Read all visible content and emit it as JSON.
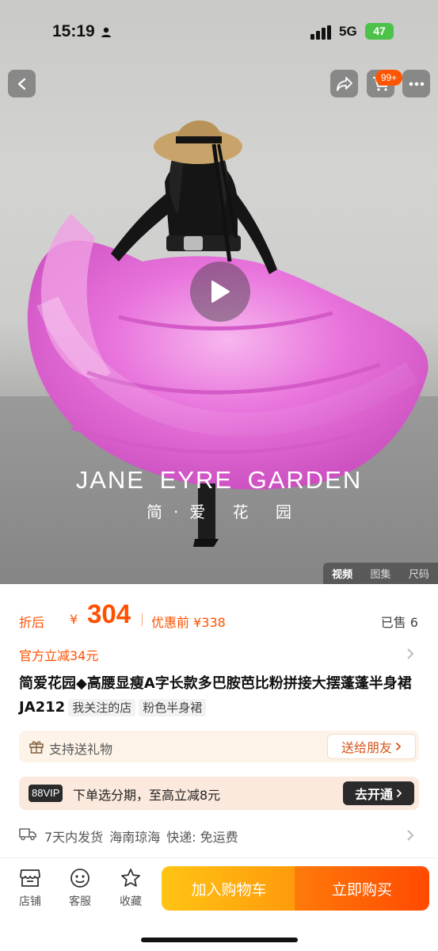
{
  "status_bar": {
    "time": "15:19",
    "network": "5G",
    "battery": "47"
  },
  "header": {
    "cart_badge": "99+"
  },
  "media": {
    "brand_en": "JANE EYRE GARDEN",
    "brand_cn": "简·爱 花 园",
    "tabs": [
      {
        "label": "视频",
        "active": true
      },
      {
        "label": "图集",
        "active": false
      },
      {
        "label": "尺码",
        "active": false
      }
    ]
  },
  "price": {
    "label": "折后",
    "currency": "¥",
    "value": "304",
    "original_label": "优惠前 ¥338",
    "sold": "已售 6"
  },
  "discount": {
    "text": "官方立减34元"
  },
  "product": {
    "title": "简爱花园◆高腰显瘦A字长款多巴胺芭比粉拼接大摆蓬蓬半身裙 JA212",
    "tags": [
      "我关注的店",
      "粉色半身裙"
    ]
  },
  "gift": {
    "text": "支持送礼物",
    "button": "送给朋友"
  },
  "vip": {
    "badge": "88VIP",
    "text": "下单选分期，至高立减8元",
    "button": "去开通"
  },
  "shipping": {
    "items": [
      "7天内发货",
      "海南琼海",
      "快递: 免运费"
    ]
  },
  "bottom_bar": {
    "nav": [
      {
        "label": "店铺",
        "icon": "store-icon"
      },
      {
        "label": "客服",
        "icon": "customer-service-icon"
      },
      {
        "label": "收藏",
        "icon": "star-icon"
      }
    ],
    "add_to_cart": "加入购物车",
    "buy_now": "立即购买"
  },
  "colors": {
    "accent": "#ff5000",
    "cart_button": "#ffb00f",
    "buy_button": "#ff5a00",
    "skirt_pink": "#e872d8"
  }
}
